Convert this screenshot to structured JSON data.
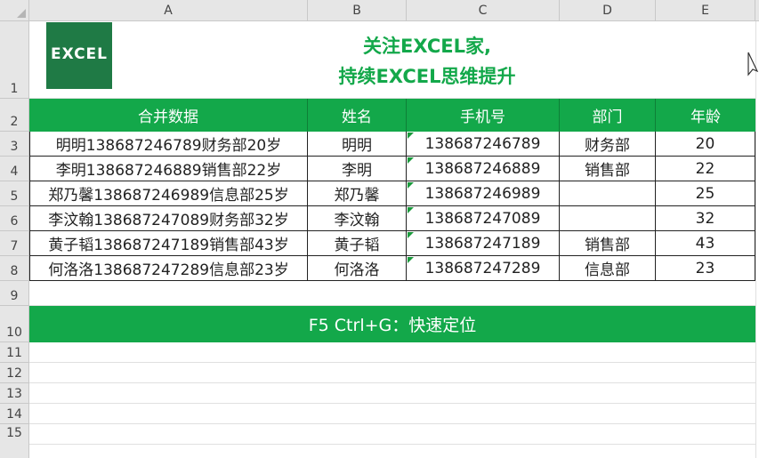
{
  "columns": [
    "A",
    "B",
    "C",
    "D",
    "E"
  ],
  "rows": [
    "1",
    "2",
    "3",
    "4",
    "5",
    "6",
    "7",
    "8",
    "9",
    "10",
    "11",
    "12",
    "13",
    "14",
    "15"
  ],
  "logo": {
    "text": "EXCEL"
  },
  "title": {
    "line1": "关注EXCEL家,",
    "line2": "持续EXCEL思维提升"
  },
  "table": {
    "headers": [
      "合并数据",
      "姓名",
      "手机号",
      "部门",
      "年龄"
    ],
    "rows": [
      [
        "明明13868724678​9财务部20岁",
        "明明",
        "13868724678​9",
        "财务部",
        "20"
      ],
      [
        "李明13868724688​9销售部22岁",
        "李明",
        "13868724688​9",
        "销售部",
        "22"
      ],
      [
        "郑乃馨13868724698​9信息部25岁",
        "郑乃馨",
        "13868724698​9",
        "",
        "25"
      ],
      [
        "李汶翰13868724708​9财务部32岁",
        "李汶翰",
        "13868724708​9",
        "",
        "32"
      ],
      [
        "黄子韬13868724718​9销售部43岁",
        "黄子韬",
        "13868724718​9",
        "销售部",
        "43"
      ],
      [
        "何洛洛13868724728​9信息部23岁",
        "何洛洛",
        "13868724728​9",
        "信息部",
        "23"
      ]
    ]
  },
  "banner": {
    "text": "F5 Ctrl+G：快速定位"
  },
  "colors": {
    "accent": "#13a84a",
    "logo_bg": "#1f7a45"
  }
}
